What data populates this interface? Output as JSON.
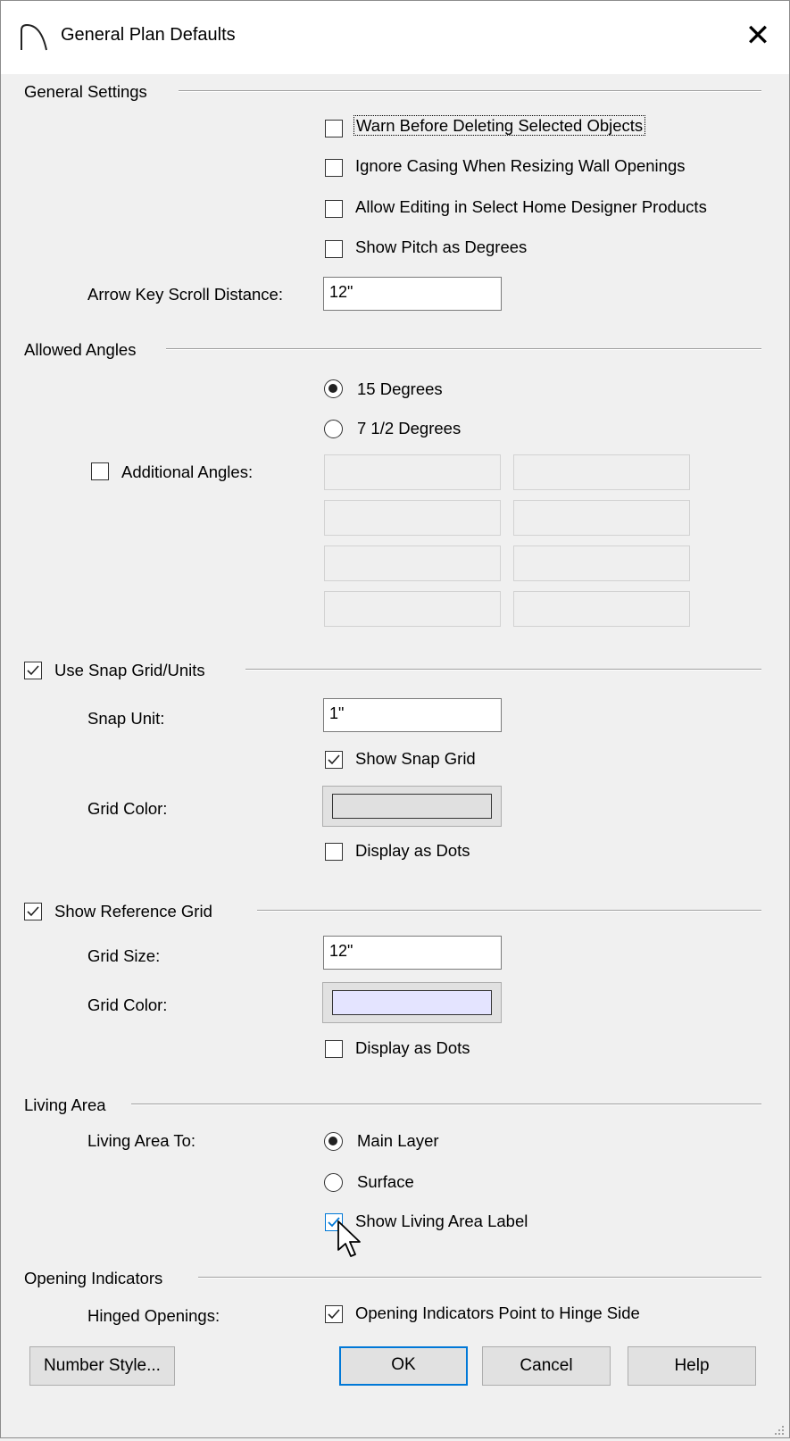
{
  "dialog": {
    "title": "General Plan Defaults",
    "close_glyph": "✕",
    "icon": "arch-icon"
  },
  "general_settings": {
    "title": "General Settings",
    "options": [
      {
        "label": "Warn Before Deleting Selected Objects",
        "checked": false
      },
      {
        "label": "Ignore Casing When Resizing Wall Openings",
        "checked": false
      },
      {
        "label": "Allow Editing in Select Home Designer Products",
        "checked": false
      },
      {
        "label": "Show Pitch as Degrees",
        "checked": false
      }
    ],
    "arrow_key_label": "Arrow Key Scroll Distance:",
    "arrow_key_value": "12\""
  },
  "allowed_angles": {
    "title": "Allowed Angles",
    "radios": [
      {
        "label": "15 Degrees",
        "selected": true
      },
      {
        "label": "7 1/2 Degrees",
        "selected": false
      }
    ],
    "additional_label": "Additional Angles:",
    "additional_checked": false
  },
  "snap_grid": {
    "title": "Use Snap Grid/Units",
    "checked": true,
    "snap_unit_label": "Snap Unit:",
    "snap_unit_value": "1\"",
    "show_snap_grid_label": "Show Snap Grid",
    "show_snap_grid_checked": true,
    "grid_color_label": "Grid Color:",
    "grid_color": "#e0e0e0",
    "display_dots_label": "Display as Dots",
    "display_dots_checked": false
  },
  "reference_grid": {
    "title": "Show Reference Grid",
    "checked": true,
    "grid_size_label": "Grid Size:",
    "grid_size_value": "12\"",
    "grid_color_label": "Grid Color:",
    "grid_color": "#e4e4ff",
    "display_dots_label": "Display as Dots",
    "display_dots_checked": false
  },
  "living_area": {
    "title": "Living Area",
    "to_label": "Living Area To:",
    "radios": [
      {
        "label": "Main Layer",
        "selected": true
      },
      {
        "label": "Surface",
        "selected": false
      }
    ],
    "show_label_text": "Show Living Area Label",
    "show_label_checked": true
  },
  "opening_indicators": {
    "title": "Opening Indicators",
    "hinged_label": "Hinged Openings:",
    "point_label": "Opening Indicators Point to Hinge Side",
    "point_checked": true
  },
  "buttons": {
    "number_style": "Number Style...",
    "ok": "OK",
    "cancel": "Cancel",
    "help": "Help"
  },
  "colors": {
    "accent": "#0078d7",
    "checkbox_hover": "#0078d7"
  }
}
